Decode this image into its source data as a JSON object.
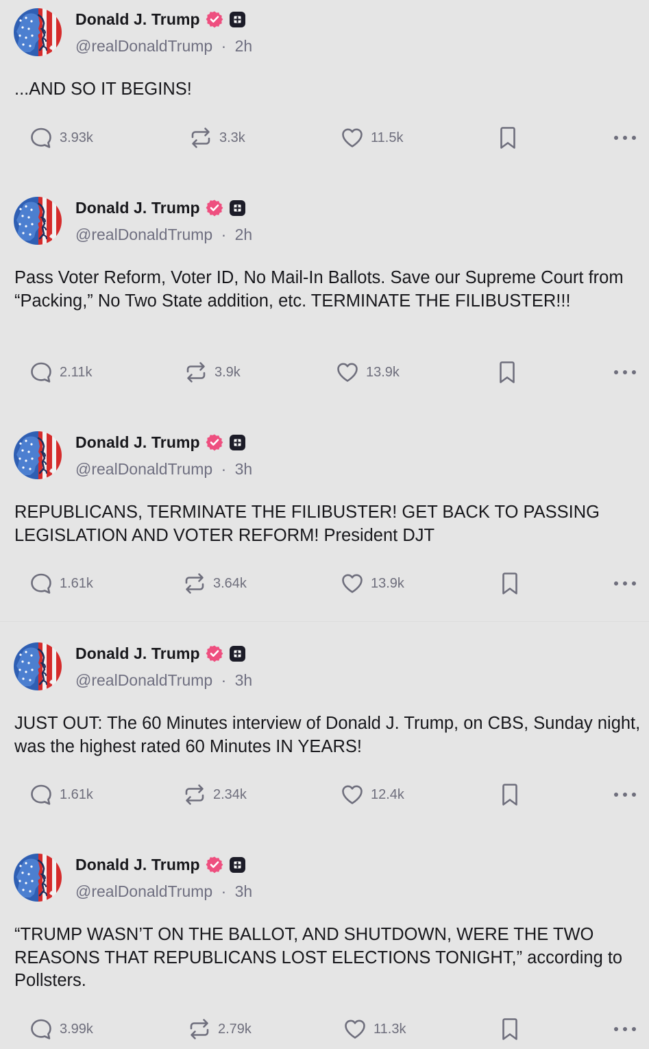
{
  "colors": {
    "background": "#e5e5e5",
    "text": "#17171b",
    "muted": "#6f6f80",
    "icon": "#6e6e7c",
    "verified_badge": "#ee4f7f",
    "plus_badge": "#1c1c28"
  },
  "icons": {
    "reply": "reply-bubble-icon",
    "repost": "repost-arrows-icon",
    "like": "heart-icon",
    "bookmark": "bookmark-icon",
    "more": "ellipsis-icon",
    "verified": "verified-badge-icon",
    "plus": "plus-badge-icon"
  },
  "posts": [
    {
      "author_name": "Donald J. Trump",
      "handle": "@realDonaldTrump",
      "separator": "·",
      "time": "2h",
      "text": "...AND SO IT BEGINS!",
      "replies": "3.93k",
      "reposts": "3.3k",
      "likes": "11.5k"
    },
    {
      "author_name": "Donald J. Trump",
      "handle": "@realDonaldTrump",
      "separator": "·",
      "time": "2h",
      "text": "Pass Voter Reform, Voter ID, No Mail-In Ballots. Save our Supreme Court from “Packing,” No Two State addition, etc. TERMINATE THE FILIBUSTER!!!",
      "replies": "2.11k",
      "reposts": "3.9k",
      "likes": "13.9k"
    },
    {
      "author_name": "Donald J. Trump",
      "handle": "@realDonaldTrump",
      "separator": "·",
      "time": "3h",
      "text": "REPUBLICANS, TERMINATE THE FILIBUSTER! GET BACK TO PASSING LEGISLATION AND VOTER REFORM! President DJT",
      "replies": "1.61k",
      "reposts": "3.64k",
      "likes": "13.9k"
    },
    {
      "author_name": "Donald J. Trump",
      "handle": "@realDonaldTrump",
      "separator": "·",
      "time": "3h",
      "text": "JUST OUT: The 60 Minutes interview of Donald J. Trump, on CBS, Sunday night, was the highest rated 60 Minutes IN YEARS!",
      "replies": "1.61k",
      "reposts": "2.34k",
      "likes": "12.4k"
    },
    {
      "author_name": "Donald J. Trump",
      "handle": "@realDonaldTrump",
      "separator": "·",
      "time": "3h",
      "text": "“TRUMP WASN’T ON THE BALLOT, AND SHUTDOWN, WERE THE TWO REASONS THAT REPUBLICANS LOST ELECTIONS TONIGHT,” according to Pollsters.",
      "replies": "3.99k",
      "reposts": "2.79k",
      "likes": "11.3k"
    }
  ]
}
